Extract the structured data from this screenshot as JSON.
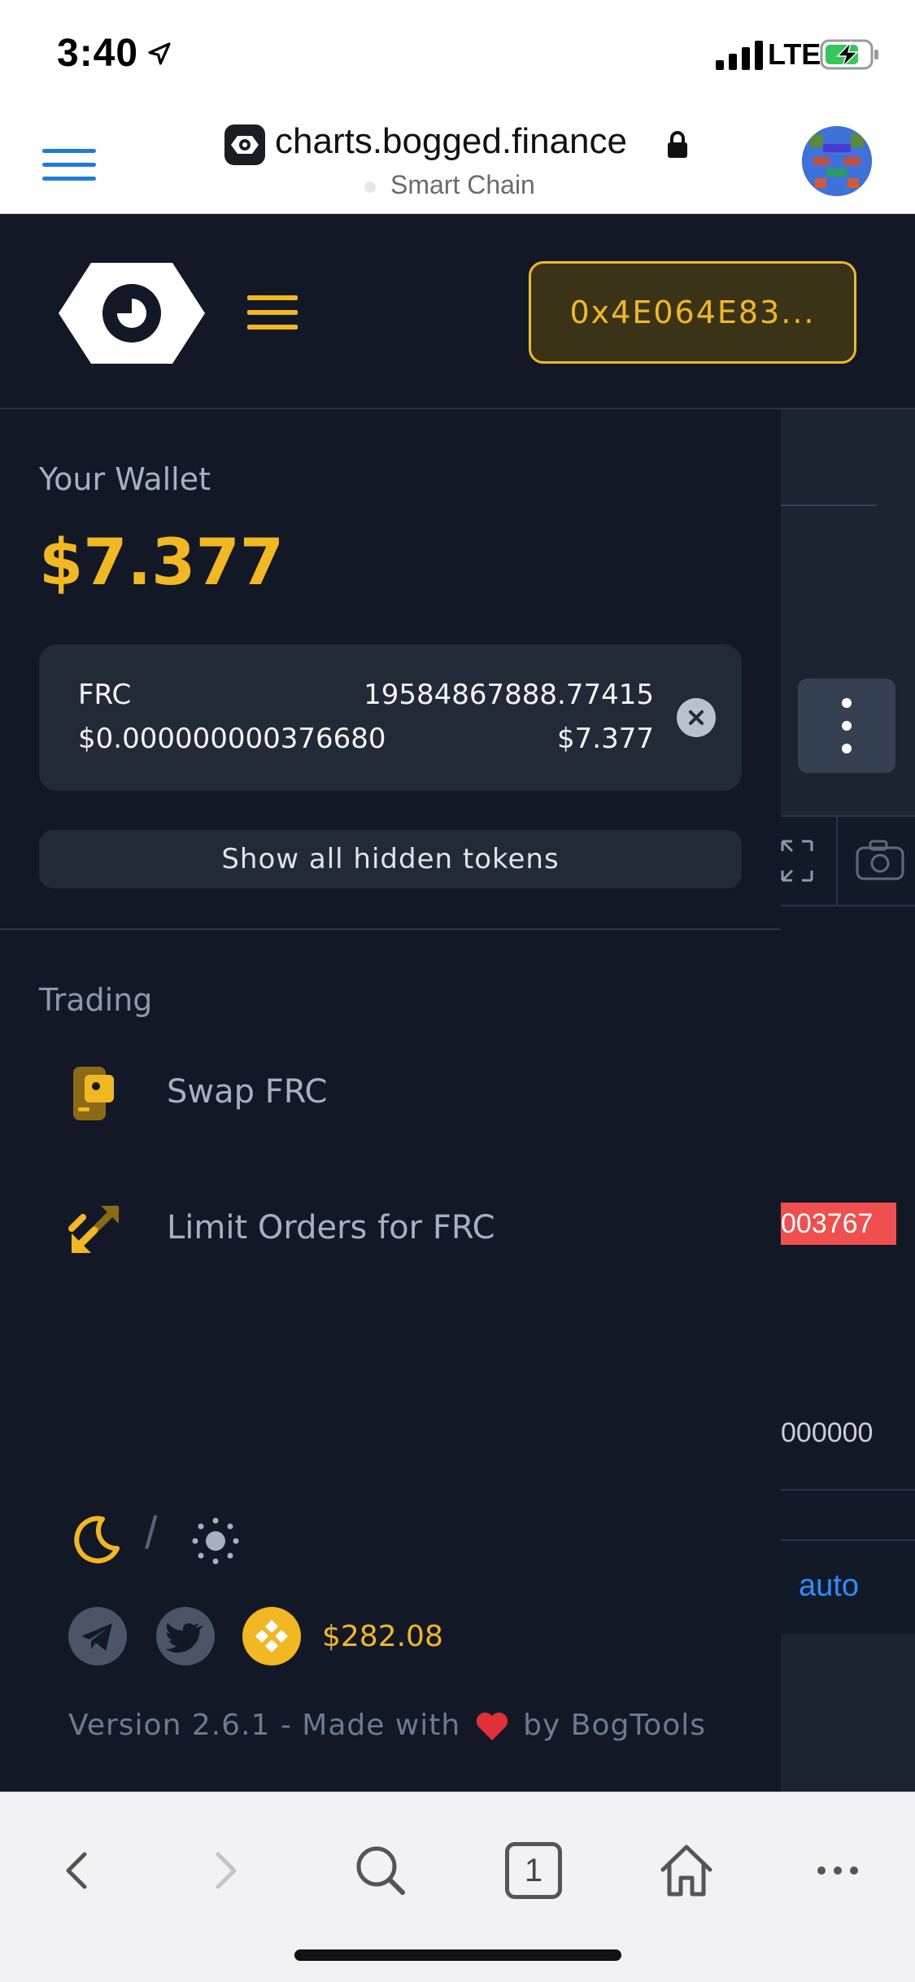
{
  "status_bar": {
    "time": "3:40",
    "network": "LTE"
  },
  "browser": {
    "url": "charts.bogged.finance",
    "subtitle": "Smart Chain",
    "tab_count": "1"
  },
  "header": {
    "wallet_address": "0x4E064E83..."
  },
  "wallet": {
    "title": "Your Wallet",
    "balance": "$7.377",
    "tokens": [
      {
        "symbol": "FRC",
        "amount": "19584867888.77415",
        "price": "$0.000000000376680",
        "value": "$7.377"
      }
    ],
    "show_hidden_label": "Show all hidden tokens"
  },
  "trading": {
    "heading": "Trading",
    "items": [
      {
        "label": "Swap FRC",
        "icon": "wallet-icon"
      },
      {
        "label": "Limit Orders for FRC",
        "icon": "arrows-icon"
      }
    ]
  },
  "footer": {
    "theme_separator": "/",
    "bnb_price": "$282.08",
    "version_prefix": "Version 2.6.1 - Made with",
    "version_suffix": "by BogTools"
  },
  "background": {
    "price_tag": "003767",
    "axis_value": "000000",
    "auto_label": "auto"
  },
  "colors": {
    "accent": "#f2b823",
    "background": "#121826",
    "card": "#222a38",
    "price_tag": "#ef4f4f",
    "link": "#2f8cff"
  }
}
